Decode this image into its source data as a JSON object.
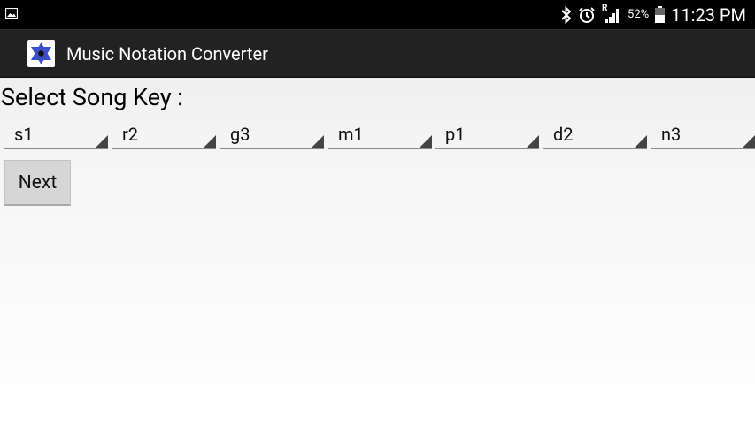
{
  "status_bar": {
    "battery_percent": "52%",
    "time": "11:23 PM",
    "roaming_indicator": "R",
    "icons": [
      "image-notification-icon",
      "bluetooth-icon",
      "alarm-icon",
      "signal-icon",
      "battery-icon"
    ]
  },
  "action_bar": {
    "app_title": "Music Notation Converter",
    "app_icon": "star-of-david-icon"
  },
  "main": {
    "select_key_label": "Select Song Key :",
    "spinners": [
      {
        "value": "s1"
      },
      {
        "value": "r2"
      },
      {
        "value": "g3"
      },
      {
        "value": "m1"
      },
      {
        "value": "p1"
      },
      {
        "value": "d2"
      },
      {
        "value": "n3"
      }
    ],
    "next_button_label": "Next"
  }
}
